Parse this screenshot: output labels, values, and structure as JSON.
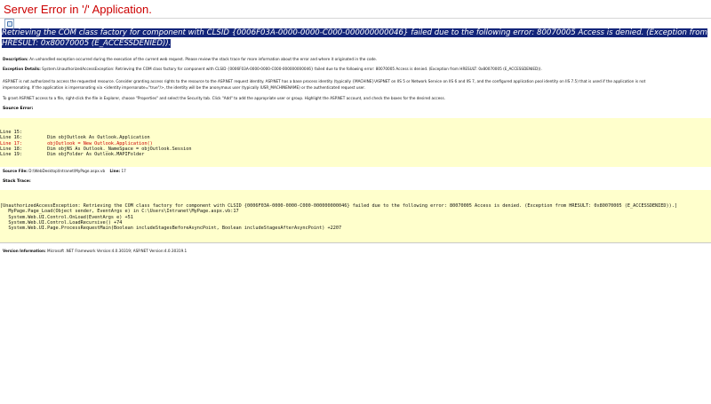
{
  "page": {
    "title": "Server Error in '/' Application.",
    "error_message": "Retrieving the COM class factory for component with CLSID {0006F03A-0000-0000-C000-000000000046} failed due to the following error: 80070005 Access is denied. (Exception from HRESULT: 0x80070005 (E_ACCESSDENIED)).",
    "description_label": "Description:",
    "description_text": " An unhandled exception occurred during the execution of the current web request. Please review the stack trace for more information about the error and where it originated in the code.",
    "exception_label": "Exception Details:",
    "exception_text": " System.UnauthorizedAccessException: Retrieving the COM class factory for component with CLSID {0006F03A-0000-0000-C000-000000000046} failed due to the following error: 80070005 Access is denied. (Exception from HRESULT: 0x80070005 (E_ACCESSDENIED)).",
    "aspnet_line1": "ASP.NET is not authorized to access the requested resource. Consider granting access rights to the resource to the ASP.NET request identity. ASP.NET has a base process identity (typically {MACHINE}\\ASPNET on IIS 5 or Network Service on IIS 6 and IIS 7, and the configured application pool identity on IIS 7.5) that is used if the application is not",
    "aspnet_line2": "impersonating. If the application is impersonating via <identity impersonate=\"true\"/>, the identity will be the anonymous user (typically IUSR_MACHINENAME) or the authenticated request user.",
    "aspnet_line3": "To grant ASP.NET access to a file, right-click the file in Explorer, choose \"Properties\" and select the Security tab. Click \"Add\" to add the appropriate user or group. Highlight the ASP.NET account, and check the boxes for the desired access.",
    "source_error_label": "Source Error:",
    "source_lines": [
      "Line 15:",
      "Line 16:         Dim objOutlook As Outlook.Application",
      "Line 17:         objOutlook = New Outlook.Application()",
      "Line 18:         Dim objNS As Outlook._NameSpace = objOutlook.Session",
      "Line 19:         Dim objFolder As Outlook.MAPIFolder"
    ],
    "source_file_label": "Source File:",
    "source_file_value": " D:\\WebDesktop\\Intranet\\MyPage.aspx.vb",
    "line_label": "Line:",
    "line_value": " 17",
    "stack_label": "Stack Trace:",
    "stack_lines": [
      "[UnauthorizedAccessException: Retrieving the COM class factory for component with CLSID {0006F03A-0000-0000-C000-000000000046} failed due to the following error: 80070005 Access is denied. (Exception from HRESULT: 0x80070005 (E_ACCESSDENIED)).]",
      "   MyPage.Page_Load(Object sender, EventArgs e) in C:\\Users\\Intranet\\MyPage.aspx.vb:17",
      "   System.Web.UI.Control.OnLoad(EventArgs e) +51",
      "   System.Web.UI.Control.LoadRecursive() +74",
      "   System.Web.UI.Page.ProcessRequestMain(Boolean includeStagesBeforeAsyncPoint, Boolean includeStagesAfterAsyncPoint) +2207"
    ],
    "version_label": "Version Information:",
    "version_text": " Microsoft .NET Framework Version:4.0.30319; ASP.NET Version:4.0.30319.1"
  }
}
